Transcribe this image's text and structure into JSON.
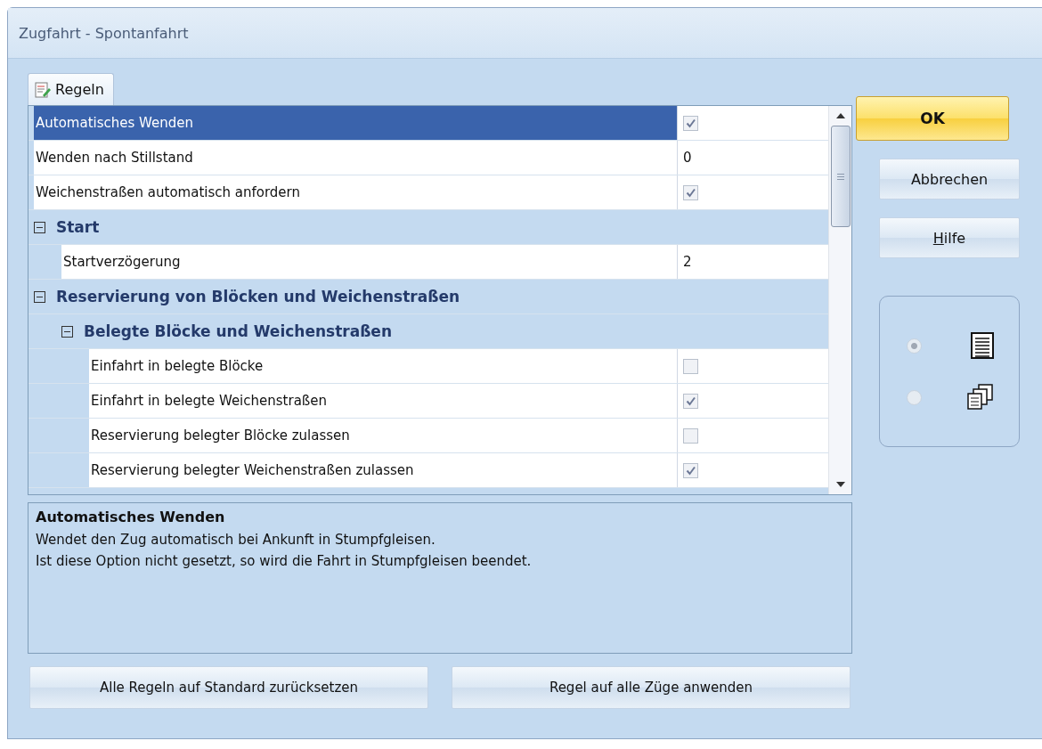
{
  "window": {
    "title": "Zugfahrt - Spontanfahrt"
  },
  "tabs": [
    {
      "label": "Regeln",
      "selected": true
    }
  ],
  "grid": {
    "rows": [
      {
        "kind": "check",
        "label": "Automatisches Wenden",
        "checked": true,
        "selected": true
      },
      {
        "kind": "value",
        "label": "Wenden nach Stillstand",
        "value": "0",
        "selected": false
      },
      {
        "kind": "check",
        "label": "Weichenstraßen automatisch anfordern",
        "checked": true,
        "selected": false
      },
      {
        "kind": "category",
        "label": "Start",
        "expanded": true,
        "children": [
          {
            "kind": "value",
            "label": "Startverzögerung",
            "value": "2",
            "selected": false
          }
        ]
      },
      {
        "kind": "category",
        "label": "Reservierung von Blöcken und Weichenstraßen",
        "expanded": true,
        "children": [
          {
            "kind": "category",
            "label": "Belegte Blöcke und Weichenstraßen",
            "expanded": true,
            "children": [
              {
                "kind": "check",
                "label": "Einfahrt in belegte Blöcke",
                "checked": false,
                "selected": false
              },
              {
                "kind": "check",
                "label": "Einfahrt in belegte Weichenstraßen",
                "checked": true,
                "selected": false
              },
              {
                "kind": "check",
                "label": "Reservierung belegter Blöcke zulassen",
                "checked": false,
                "selected": false
              },
              {
                "kind": "check",
                "label": "Reservierung belegter Weichenstraßen zulassen",
                "checked": true,
                "selected": false
              }
            ]
          }
        ]
      }
    ]
  },
  "description": {
    "title": "Automatisches Wenden",
    "lines": [
      "Wendet den Zug automatisch bei Ankunft in Stumpfgleisen.",
      "Ist diese Option nicht gesetzt, so wird die Fahrt in Stumpfgleisen beendet."
    ]
  },
  "buttons": [
    {
      "label": "OK",
      "kind": "default"
    },
    {
      "label": "Abbrechen",
      "kind": "normal"
    },
    {
      "label": "Hilfe",
      "kind": "normal",
      "first_letter_underlined": true
    }
  ],
  "view_options": [
    {
      "kind": "list",
      "selected": true
    },
    {
      "kind": "windows",
      "selected": false
    }
  ],
  "bottom_buttons": [
    {
      "label": "Alle Regeln auf Standard zurücksetzen"
    },
    {
      "label": "Regel auf alle Züge anwenden"
    }
  ]
}
